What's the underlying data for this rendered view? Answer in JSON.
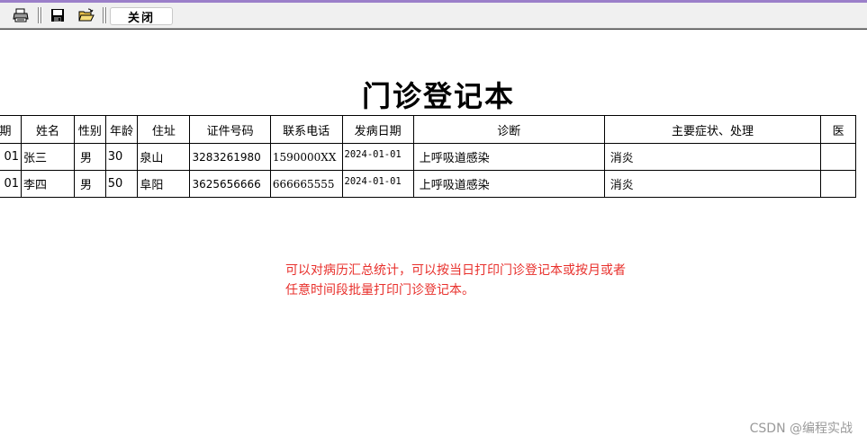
{
  "toolbar": {
    "print_icon": "printer-icon",
    "save_icon": "floppy-disk-icon",
    "open_icon": "open-folder-icon",
    "close_label": "关闭"
  },
  "report": {
    "title": "门诊登记本",
    "columns": [
      "期",
      "姓名",
      "性别",
      "年龄",
      "住址",
      "证件号码",
      "联系电话",
      "发病日期",
      "诊断",
      "主要症状、处理",
      "医"
    ],
    "rows": [
      {
        "date_tail": "01",
        "name": "张三",
        "gender": "男",
        "age": "30",
        "address": "泉山",
        "id_number": "3283261980",
        "phone": "1590000XX",
        "onset_date": "2024-01-01",
        "diagnosis": "上呼吸道感染",
        "treatment": "消炎",
        "doctor": ""
      },
      {
        "date_tail": "01",
        "name": "李四",
        "gender": "男",
        "age": "50",
        "address": "阜阳",
        "id_number": "3625656666",
        "phone": "666665555",
        "onset_date": "2024-01-01",
        "diagnosis": "上呼吸道感染",
        "treatment": "消炎",
        "doctor": ""
      }
    ]
  },
  "annotation": {
    "line1": "可以对病历汇总统计，可以按当日打印门诊登记本或按月或者",
    "line2": "任意时间段批量打印门诊登记本。"
  },
  "watermark": "CSDN @编程实战",
  "colors": {
    "accent": "#9b7fc9",
    "annotation": "#e8302c",
    "watermark": "#9a9a9a"
  }
}
